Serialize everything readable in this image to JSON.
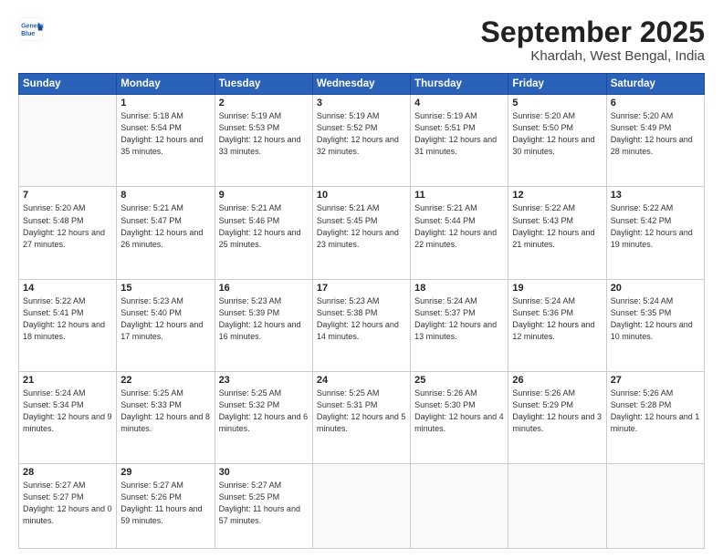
{
  "logo": {
    "line1": "General",
    "line2": "Blue"
  },
  "title": "September 2025",
  "location": "Khardah, West Bengal, India",
  "headers": [
    "Sunday",
    "Monday",
    "Tuesday",
    "Wednesday",
    "Thursday",
    "Friday",
    "Saturday"
  ],
  "weeks": [
    [
      {
        "day": "",
        "info": ""
      },
      {
        "day": "1",
        "info": "Sunrise: 5:18 AM\nSunset: 5:54 PM\nDaylight: 12 hours\nand 35 minutes."
      },
      {
        "day": "2",
        "info": "Sunrise: 5:19 AM\nSunset: 5:53 PM\nDaylight: 12 hours\nand 33 minutes."
      },
      {
        "day": "3",
        "info": "Sunrise: 5:19 AM\nSunset: 5:52 PM\nDaylight: 12 hours\nand 32 minutes."
      },
      {
        "day": "4",
        "info": "Sunrise: 5:19 AM\nSunset: 5:51 PM\nDaylight: 12 hours\nand 31 minutes."
      },
      {
        "day": "5",
        "info": "Sunrise: 5:20 AM\nSunset: 5:50 PM\nDaylight: 12 hours\nand 30 minutes."
      },
      {
        "day": "6",
        "info": "Sunrise: 5:20 AM\nSunset: 5:49 PM\nDaylight: 12 hours\nand 28 minutes."
      }
    ],
    [
      {
        "day": "7",
        "info": "Sunrise: 5:20 AM\nSunset: 5:48 PM\nDaylight: 12 hours\nand 27 minutes."
      },
      {
        "day": "8",
        "info": "Sunrise: 5:21 AM\nSunset: 5:47 PM\nDaylight: 12 hours\nand 26 minutes."
      },
      {
        "day": "9",
        "info": "Sunrise: 5:21 AM\nSunset: 5:46 PM\nDaylight: 12 hours\nand 25 minutes."
      },
      {
        "day": "10",
        "info": "Sunrise: 5:21 AM\nSunset: 5:45 PM\nDaylight: 12 hours\nand 23 minutes."
      },
      {
        "day": "11",
        "info": "Sunrise: 5:21 AM\nSunset: 5:44 PM\nDaylight: 12 hours\nand 22 minutes."
      },
      {
        "day": "12",
        "info": "Sunrise: 5:22 AM\nSunset: 5:43 PM\nDaylight: 12 hours\nand 21 minutes."
      },
      {
        "day": "13",
        "info": "Sunrise: 5:22 AM\nSunset: 5:42 PM\nDaylight: 12 hours\nand 19 minutes."
      }
    ],
    [
      {
        "day": "14",
        "info": "Sunrise: 5:22 AM\nSunset: 5:41 PM\nDaylight: 12 hours\nand 18 minutes."
      },
      {
        "day": "15",
        "info": "Sunrise: 5:23 AM\nSunset: 5:40 PM\nDaylight: 12 hours\nand 17 minutes."
      },
      {
        "day": "16",
        "info": "Sunrise: 5:23 AM\nSunset: 5:39 PM\nDaylight: 12 hours\nand 16 minutes."
      },
      {
        "day": "17",
        "info": "Sunrise: 5:23 AM\nSunset: 5:38 PM\nDaylight: 12 hours\nand 14 minutes."
      },
      {
        "day": "18",
        "info": "Sunrise: 5:24 AM\nSunset: 5:37 PM\nDaylight: 12 hours\nand 13 minutes."
      },
      {
        "day": "19",
        "info": "Sunrise: 5:24 AM\nSunset: 5:36 PM\nDaylight: 12 hours\nand 12 minutes."
      },
      {
        "day": "20",
        "info": "Sunrise: 5:24 AM\nSunset: 5:35 PM\nDaylight: 12 hours\nand 10 minutes."
      }
    ],
    [
      {
        "day": "21",
        "info": "Sunrise: 5:24 AM\nSunset: 5:34 PM\nDaylight: 12 hours\nand 9 minutes."
      },
      {
        "day": "22",
        "info": "Sunrise: 5:25 AM\nSunset: 5:33 PM\nDaylight: 12 hours\nand 8 minutes."
      },
      {
        "day": "23",
        "info": "Sunrise: 5:25 AM\nSunset: 5:32 PM\nDaylight: 12 hours\nand 6 minutes."
      },
      {
        "day": "24",
        "info": "Sunrise: 5:25 AM\nSunset: 5:31 PM\nDaylight: 12 hours\nand 5 minutes."
      },
      {
        "day": "25",
        "info": "Sunrise: 5:26 AM\nSunset: 5:30 PM\nDaylight: 12 hours\nand 4 minutes."
      },
      {
        "day": "26",
        "info": "Sunrise: 5:26 AM\nSunset: 5:29 PM\nDaylight: 12 hours\nand 3 minutes."
      },
      {
        "day": "27",
        "info": "Sunrise: 5:26 AM\nSunset: 5:28 PM\nDaylight: 12 hours\nand 1 minute."
      }
    ],
    [
      {
        "day": "28",
        "info": "Sunrise: 5:27 AM\nSunset: 5:27 PM\nDaylight: 12 hours\nand 0 minutes."
      },
      {
        "day": "29",
        "info": "Sunrise: 5:27 AM\nSunset: 5:26 PM\nDaylight: 11 hours\nand 59 minutes."
      },
      {
        "day": "30",
        "info": "Sunrise: 5:27 AM\nSunset: 5:25 PM\nDaylight: 11 hours\nand 57 minutes."
      },
      {
        "day": "",
        "info": ""
      },
      {
        "day": "",
        "info": ""
      },
      {
        "day": "",
        "info": ""
      },
      {
        "day": "",
        "info": ""
      }
    ]
  ]
}
